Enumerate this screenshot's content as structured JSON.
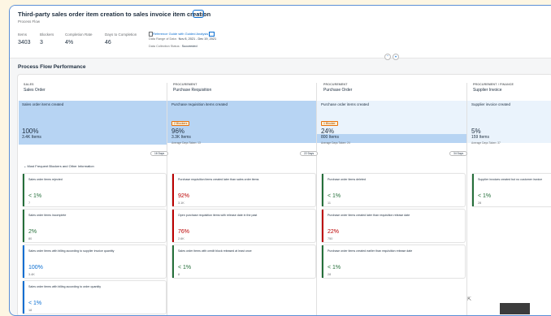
{
  "header": {
    "title": "Third-party sales order item creation to sales invoice item creation",
    "title_chip": "⌄",
    "subtitle": "Process Flow",
    "kpis": [
      {
        "label": "Items",
        "value": "3403"
      },
      {
        "label": "Blockers",
        "value": "3"
      },
      {
        "label": "Completion Rate",
        "value": "4%"
      },
      {
        "label": "Days to Completion",
        "value": "46"
      }
    ],
    "link": "Reference Guide with Guided Analysis",
    "date_range_label": "Data Range of Data:",
    "date_range_value": "Nov 8, 2021 - Dec 19, 2021",
    "status_label": "Data Collection Status:",
    "status_value": "Succeeded"
  },
  "controls": {
    "collapse": "⌃",
    "pin": "⌖"
  },
  "section_title": "Process Flow Performance",
  "steps": [
    {
      "category": "SALES",
      "name": "Sales Order",
      "band_label": "Sales order items created",
      "pct": "100%",
      "items": "3.4K Items",
      "blocker": "",
      "avg": ""
    },
    {
      "category": "PROCUREMENT",
      "name": "Purchase Requisition",
      "band_label": "Purchase requisition items created",
      "pct": "96%",
      "items": "3.3K Items",
      "blocker": "2 Blockers",
      "avg": "Average Days Taken: 13"
    },
    {
      "category": "PROCUREMENT",
      "name": "Purchase Order",
      "band_label": "Purchase order items created",
      "pct": "24%",
      "items": "800 Items",
      "blocker": "1 Blocker",
      "avg": "Average Days Taken: 24"
    },
    {
      "category": "PROCUREMENT / FINANCE",
      "name": "Supplier Invoice",
      "band_label": "Supplier invoice created",
      "pct": "5%",
      "items": "159 Items",
      "blocker": "",
      "avg": "Average Days Taken: 37"
    }
  ],
  "days_labels": [
    "16 Days",
    "22 Days",
    "34 Days"
  ],
  "frequent_blockers_label": "Most Frequent Blockers and Other Information",
  "cards": [
    [
      {
        "title": "Sales order items rejected",
        "value": "< 1%",
        "sub": "7",
        "color": "green"
      },
      {
        "title": "Sales order items incomplete",
        "value": "2%",
        "sub": "80",
        "color": "green"
      },
      {
        "title": "Sales order items with billing according to supplier invoice quantity",
        "value": "100%",
        "sub": "3.4K",
        "color": "blue"
      },
      {
        "title": "Sales order items with billing according to order quantity",
        "value": "< 1%",
        "sub": "18",
        "color": "blue"
      }
    ],
    [
      {
        "title": "Purchase requisition items created later than sales order items",
        "value": "92%",
        "sub": "3.1K",
        "color": "red"
      },
      {
        "title": "Open purchase requisition items with release date in the past",
        "value": "76%",
        "sub": "2.6K",
        "color": "red"
      },
      {
        "title": "Sales order items with credit block released at least once",
        "value": "< 1%",
        "sub": "8",
        "color": "green"
      }
    ],
    [
      {
        "title": "Purchase order items deleted",
        "value": "< 1%",
        "sub": "11",
        "color": "green"
      },
      {
        "title": "Purchase order items created later than requisition release date",
        "value": "22%",
        "sub": "750",
        "color": "red"
      },
      {
        "title": "Purchase order items created earlier than requisition release date",
        "value": "< 1%",
        "sub": "28",
        "color": "green"
      }
    ],
    [
      {
        "title": "Supplier invoices created but no customer invoice",
        "value": "< 1%",
        "sub": "28",
        "color": "green"
      }
    ]
  ]
}
